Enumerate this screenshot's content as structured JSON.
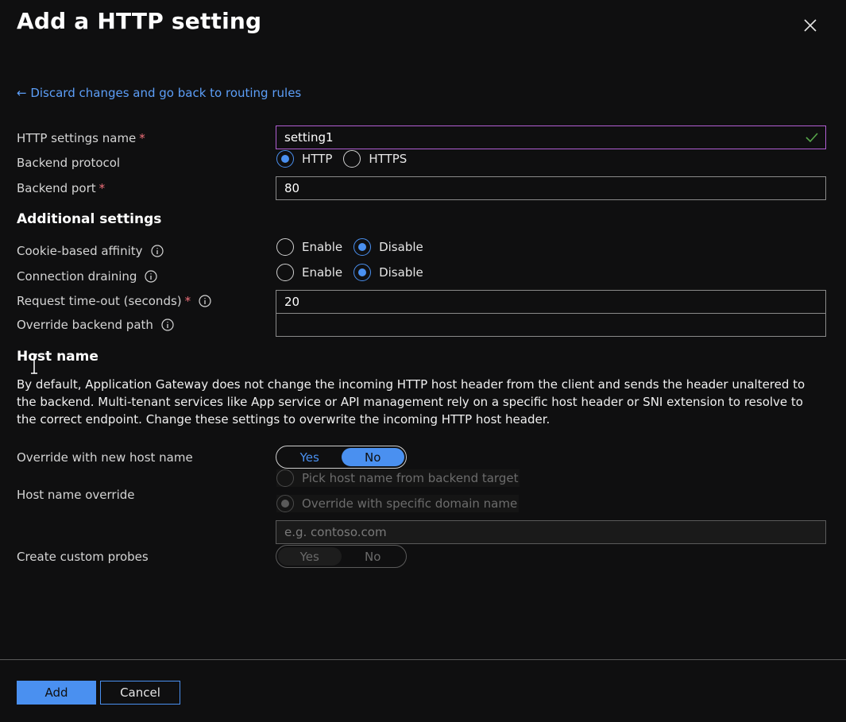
{
  "header": {
    "title": "Add a HTTP setting",
    "back_link": "← Discard changes and go back to routing rules"
  },
  "form": {
    "http_settings_name": {
      "label": "HTTP settings name",
      "value": "setting1"
    },
    "backend_protocol": {
      "label": "Backend protocol",
      "options": [
        "HTTP",
        "HTTPS"
      ],
      "selected": "HTTP"
    },
    "backend_port": {
      "label": "Backend port",
      "value": "80"
    }
  },
  "additional": {
    "heading": "Additional settings",
    "cookie_affinity": {
      "label": "Cookie-based affinity",
      "options": [
        "Enable",
        "Disable"
      ],
      "selected": "Disable"
    },
    "connection_draining": {
      "label": "Connection draining",
      "options": [
        "Enable",
        "Disable"
      ],
      "selected": "Disable"
    },
    "request_timeout": {
      "label": "Request time-out (seconds)",
      "value": "20"
    },
    "override_backend_path": {
      "label": "Override backend path",
      "value": ""
    }
  },
  "host": {
    "heading": "Host name",
    "description": "By default, Application Gateway does not change the incoming HTTP host header from the client and sends the header unaltered to the backend. Multi-tenant services like App service or API management rely on a specific host header or SNI extension to resolve to the correct endpoint. Change these settings to overwrite the incoming HTTP host header.",
    "override_new_host": {
      "label": "Override with new host name",
      "yes": "Yes",
      "no": "No",
      "selected": "No"
    },
    "host_name_override": {
      "label": "Host name override",
      "option_pick": "Pick host name from backend target",
      "option_specific": "Override with specific domain name",
      "placeholder": "e.g. contoso.com"
    },
    "custom_probes": {
      "label": "Create custom probes",
      "yes": "Yes",
      "no": "No"
    }
  },
  "footer": {
    "add_label": "Add",
    "cancel_label": "Cancel"
  },
  "colors": {
    "accent": "#4a90f0",
    "required": "#f1707b",
    "valid": "#57a64a",
    "focus_border": "#b15fd3"
  },
  "icons": {
    "close": "close-icon",
    "info": "info-icon",
    "check": "checkmark-icon"
  }
}
